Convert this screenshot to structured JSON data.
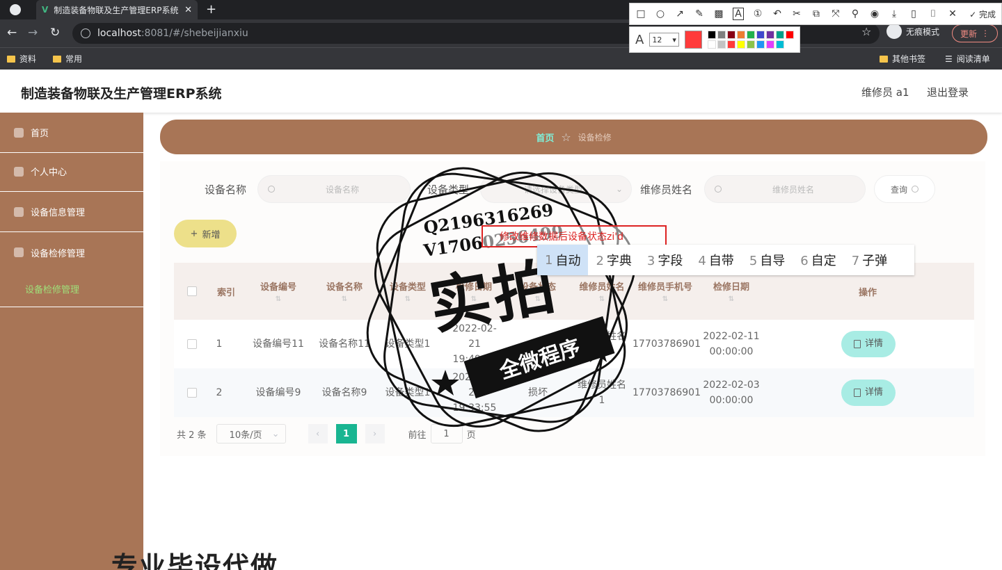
{
  "browser": {
    "tab_title": "制造装备物联及生产管理ERP系统",
    "tab_close": "✕",
    "new_tab": "+",
    "url_host": "localhost",
    "url_rest": ":8081/#/shebeijianxiu",
    "incognito_label": "无痕模式",
    "update_label": "更新",
    "bookmarks": [
      "资料",
      "常用"
    ],
    "other_bookmarks": "其他书签",
    "reading_list": "阅读清单"
  },
  "screenshot_tool": {
    "done_label": "完成",
    "font_size": "12",
    "current_color": "#ff3b3b",
    "palette": [
      "#000000",
      "#7f7f7f",
      "#880015",
      "#ed7d31",
      "#22b14c",
      "#3f48cc",
      "#7030a0",
      "#00a08a",
      "#ff0000",
      "#ffffff",
      "#c3c3c3",
      "#ff3b3b",
      "#ffff00",
      "#8bc34a",
      "#2196f3",
      "#e040fb",
      "#00bcd4"
    ]
  },
  "app": {
    "title": "制造装备物联及生产管理ERP系统",
    "user_role": "维修员 a1",
    "logout": "退出登录"
  },
  "sidebar": {
    "items": [
      {
        "label": "首页"
      },
      {
        "label": "个人中心"
      },
      {
        "label": "设备信息管理"
      },
      {
        "label": "设备检修管理"
      }
    ],
    "sub_item": "设备检修管理"
  },
  "breadcrumb": {
    "home": "首页",
    "current": "设备检修"
  },
  "search": {
    "name_label": "设备名称",
    "name_placeholder": "设备名称",
    "type_label": "设备类型",
    "type_placeholder": "请选择设备类型",
    "repairer_label": "维修员姓名",
    "repairer_placeholder": "维修员姓名",
    "query_label": "查询"
  },
  "add_label": "新增",
  "table": {
    "columns": [
      "索引",
      "设备编号",
      "设备名称",
      "设备类型",
      "检修日期",
      "设备状态",
      "维修员姓名",
      "维修员手机号",
      "检修日期",
      "操作"
    ],
    "rows": [
      {
        "index": "1",
        "code": "设备编号11",
        "name": "设备名称11",
        "type": "设备类型1",
        "date1": "2022-02-21 19:49:40",
        "status": "",
        "repairer": "维修员姓名1",
        "phone": "17703786901",
        "date2": "2022-02-11 00:00:00",
        "action": "详情"
      },
      {
        "index": "2",
        "code": "设备编号9",
        "name": "设备名称9",
        "type": "设备类型1",
        "date1": "2022-02-21 19:33:55",
        "status": "损坏",
        "repairer": "维修员姓名1",
        "phone": "17703786901",
        "date2": "2022-02-03 00:00:00",
        "action": "详情"
      }
    ]
  },
  "pager": {
    "total": "共 2 条",
    "page_size": "10条/页",
    "current": "1",
    "goto_label": "前往",
    "goto_value": "1",
    "page_suffix": "页"
  },
  "annotation": {
    "text": "修改维修数据后设备状态zi'd"
  },
  "ime": {
    "candidates": [
      {
        "num": "1",
        "text": "自动"
      },
      {
        "num": "2",
        "text": "字典"
      },
      {
        "num": "3",
        "text": "字段"
      },
      {
        "num": "4",
        "text": "自带"
      },
      {
        "num": "5",
        "text": "自导"
      },
      {
        "num": "6",
        "text": "自定"
      },
      {
        "num": "7",
        "text": "子弹"
      }
    ]
  },
  "watermark": {
    "qq": "Q2196316269",
    "vx": "V17060256499",
    "main": "实拍",
    "band": "全微程序",
    "bottom": "专业毕设代做"
  }
}
